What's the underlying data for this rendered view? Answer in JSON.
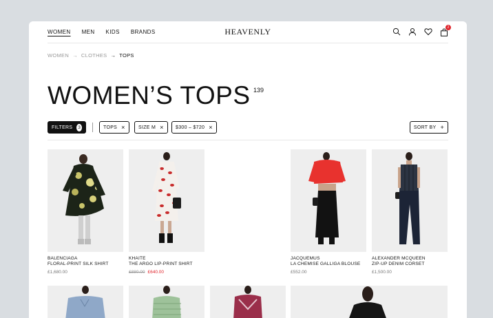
{
  "nav": {
    "links": [
      "WOMEN",
      "MEN",
      "KIDS",
      "BRANDS"
    ],
    "logo": "HEAVENLY",
    "cart_count": "2",
    "icons": [
      "search-icon",
      "user-icon",
      "heart-icon",
      "bag-icon"
    ]
  },
  "breadcrumb": [
    "WOMEN",
    "CLOTHES",
    "TOPS"
  ],
  "page": {
    "title": "WOMEN’S TOPS",
    "count": "139"
  },
  "filters": {
    "label": "FILTERS",
    "count": "3",
    "chips": [
      "TOPS",
      "SIZE M",
      "$300 – $720"
    ],
    "sort_label": "SORT BY"
  },
  "products": [
    {
      "brand": "BALENCIAGA",
      "name": "FLORAL-PRINT SILK SHIRT",
      "price": "£1,680.00",
      "old_price": "",
      "sale_price": ""
    },
    {
      "brand": "KHAITE",
      "name": "THE ARGO LIP-PRINT SHIRT",
      "price": "",
      "old_price": "£880.00",
      "sale_price": "£640.00"
    },
    {
      "brand": "JACQUEMUS",
      "name": "LA CHEMISE GALLIGA BLOUSE",
      "price": "£552.00",
      "old_price": "",
      "sale_price": ""
    },
    {
      "brand": "ALEXANDER MCQUEEN",
      "name": "ZIP-UP DENIM CORSET",
      "price": "£1,500.00",
      "old_price": "",
      "sale_price": ""
    }
  ],
  "colors": {
    "accent": "#e0242b",
    "text": "#111111",
    "muted": "#999999",
    "tile": "#eeeeee"
  }
}
